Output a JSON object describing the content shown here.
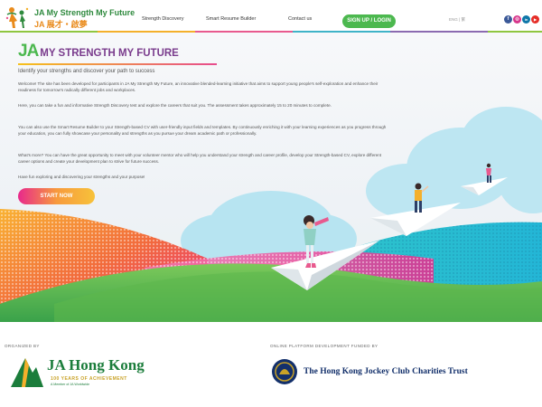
{
  "header": {
    "logo_en": "JA My Strength My Future",
    "logo_zh": "JA 展才・啟夢",
    "nav": [
      "Strength Discovery",
      "Smart Resume Builder",
      "Contact us"
    ],
    "signup_label": "SIGN UP / LOGIN",
    "lang_en": "ENG",
    "lang_sep": "|",
    "lang_zh": "繁",
    "social": [
      {
        "name": "facebook-icon",
        "glyph": "f",
        "color": "#3b5998"
      },
      {
        "name": "instagram-icon",
        "glyph": "◎",
        "color": "#d6368b"
      },
      {
        "name": "linkedin-icon",
        "glyph": "in",
        "color": "#0e76a8"
      },
      {
        "name": "youtube-icon",
        "glyph": "▶",
        "color": "#e52d27"
      }
    ]
  },
  "hero": {
    "title_ja": "JA",
    "title_rest": "MY STRENGTH MY FUTURE",
    "subtitle": "Identify your strengths and discover your path to success",
    "paragraphs": [
      "Welcome! The site has been developed for participants in JA My Strength My Future, an innovative blended-learning initiative that aims to support young people's self-exploration and enhance their readiness for tomorrow's radically different jobs and workplaces.",
      "Here, you can take a fun and informative Strength Discovery test and explore the careers that suit you. The assessment takes approximately 15 to 20 minutes to complete.",
      "You can also use the Smart Resume Builder to your Strength-based CV with user-friendly input fields and templates. By continuously enriching it with your learning experiences as you progress through your education, you can fully showcase your personality and strengths as you pursue your dream academic path or professionally.",
      "What's more? You can have the great opportunity to meet with your volunteer mentor who will help you understand your strength and career profile, develop your Strength-based CV, explore different career options and create your development plan to strive for future success.",
      "Have fun exploring and discovering your strengths and your purpose!"
    ],
    "start_label": "START NOW"
  },
  "footer": {
    "organized_label": "ORGANIZED BY",
    "funded_label": "ONLINE PLATFORM DEVELOPMENT FUNDED BY",
    "ja_name": "JA Hong Kong",
    "ja_years": "100 YEARS OF ACHIEVEMENT",
    "ja_member": "A Member of JA Worldwide",
    "hkjc_name": "The Hong Kong Jockey Club Charities Trust"
  },
  "colors": {
    "brand_green": "#4cb84f",
    "brand_purple": "#7a3c8d",
    "accent_pink": "#e8298c"
  }
}
